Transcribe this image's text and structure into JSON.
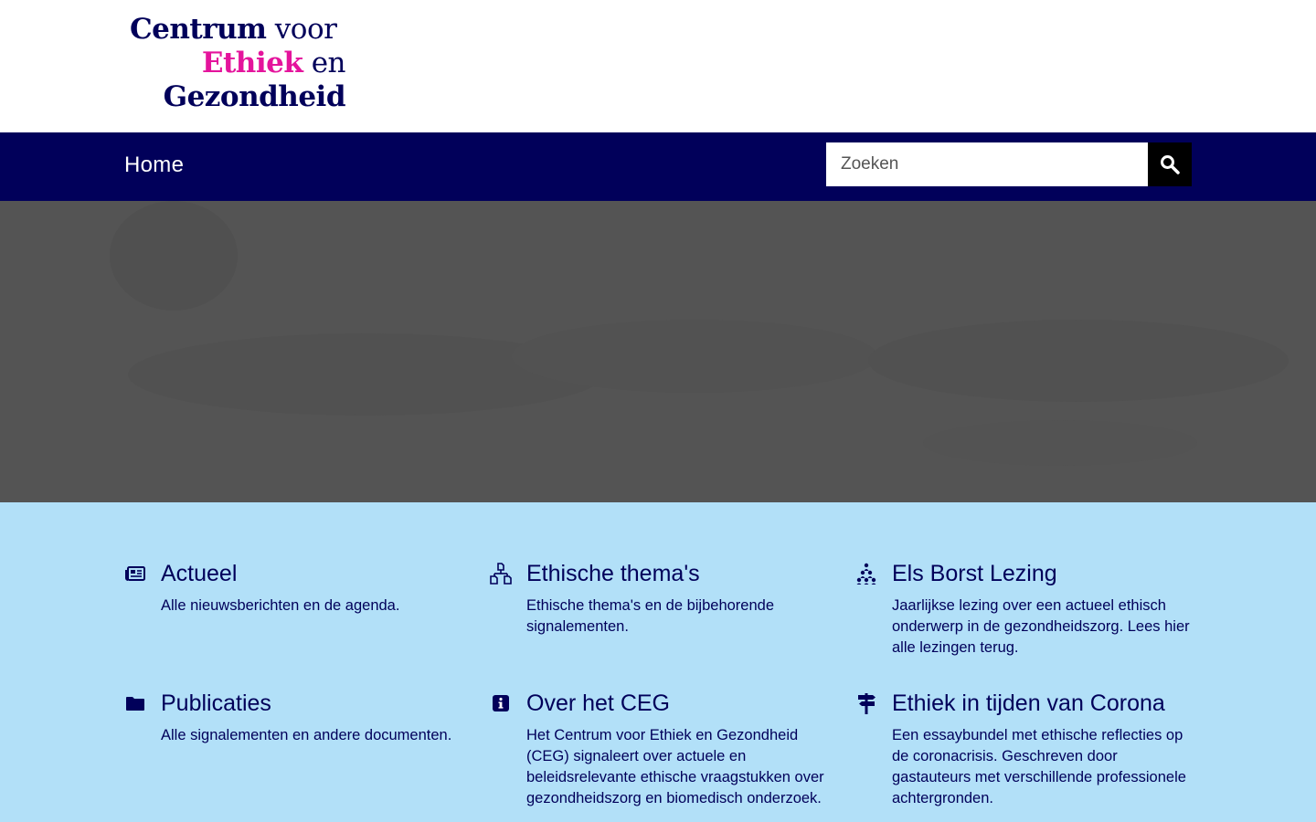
{
  "header": {
    "logo": {
      "line1_bold": "Centrum",
      "line1_light": "voor",
      "line2_pink": "Ethiek",
      "line2_light": "en",
      "line3_bold": "Gezondheid"
    }
  },
  "nav": {
    "home_label": "Home",
    "search": {
      "placeholder": "Zoeken",
      "value": "",
      "button_icon": "search-icon"
    }
  },
  "colors": {
    "navy": "#01005a",
    "pink": "#e4149c",
    "hero_gray": "#545454",
    "tiles_bg": "#b2e0f8"
  },
  "tiles": [
    {
      "icon": "newspaper-icon",
      "title": "Actueel",
      "description": "Alle nieuwsberichten en de agenda."
    },
    {
      "icon": "sitemap-icon",
      "title": "Ethische thema's",
      "description": "Ethische thema's en de bijbehorende signalementen."
    },
    {
      "icon": "people-pyramid-icon",
      "title": "Els Borst Lezing",
      "description": "Jaarlijkse lezing over een actueel ethisch onderwerp in de gezondheidszorg. Lees hier alle lezingen terug."
    },
    {
      "icon": "folder-icon",
      "title": "Publicaties",
      "description": "Alle signalementen en andere documenten."
    },
    {
      "icon": "info-icon",
      "title": "Over het CEG",
      "description": "Het Centrum voor Ethiek en Gezondheid (CEG) signaleert over actuele en beleidsrelevante ethische vraagstukken over gezondheidszorg en biomedisch onderzoek."
    },
    {
      "icon": "signpost-icon",
      "title": "Ethiek in tijden van Corona",
      "description": "Een essaybundel met ethische reflecties op de coronacrisis. Geschreven door gastauteurs met verschillende professionele achtergronden."
    }
  ]
}
